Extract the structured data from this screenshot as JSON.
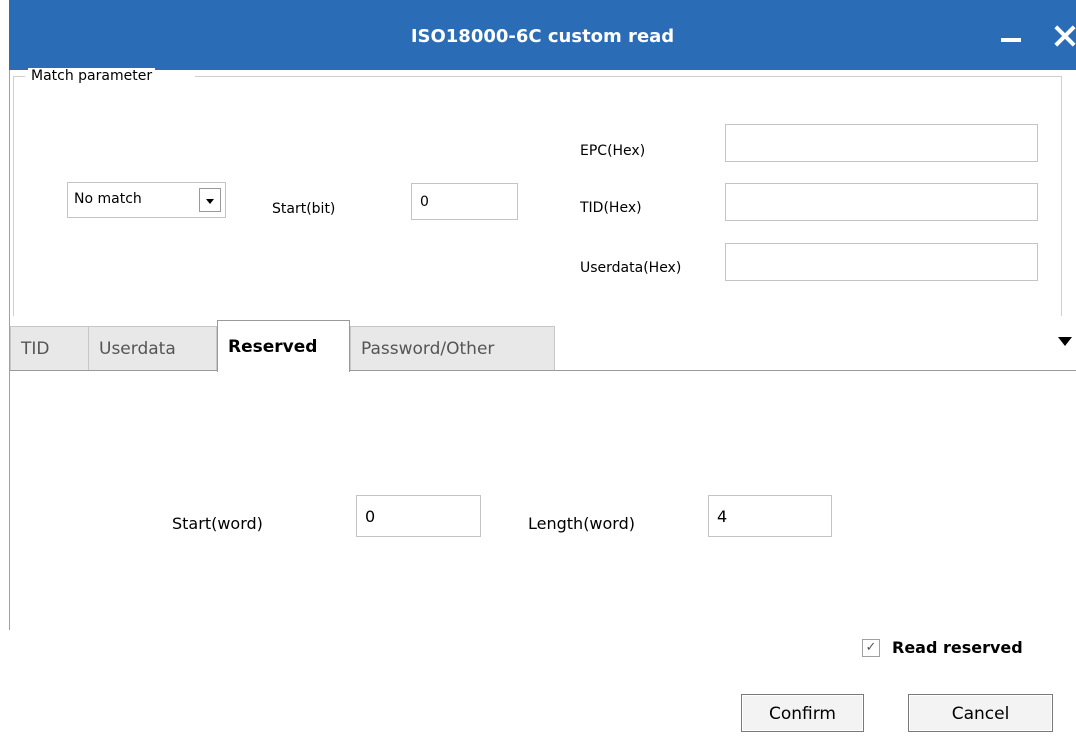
{
  "window": {
    "title": "ISO18000-6C custom read",
    "minimize_icon": "minimize-icon",
    "close_icon": "close-icon"
  },
  "match": {
    "group_label": "Match parameter",
    "mode_selected": "No match",
    "start_bit_label": "Start(bit)",
    "start_bit_value": "0",
    "epc_label": "EPC(Hex)",
    "epc_value": "",
    "tid_label": "TID(Hex)",
    "tid_value": "",
    "userdata_label": "Userdata(Hex)",
    "userdata_value": ""
  },
  "tabs": [
    {
      "label": "TID",
      "active": false
    },
    {
      "label": "Userdata",
      "active": false
    },
    {
      "label": "Reserved",
      "active": true
    },
    {
      "label": "Password/Other",
      "active": false
    }
  ],
  "tab_overflow_icon": "dropdown-arrow-icon",
  "reserved": {
    "start_word_label": "Start(word)",
    "start_word_value": "0",
    "length_word_label": "Length(word)",
    "length_word_value": "4",
    "read_reserved_label": "Read reserved",
    "read_reserved_checked": true
  },
  "buttons": {
    "confirm": "Confirm",
    "cancel": "Cancel"
  }
}
